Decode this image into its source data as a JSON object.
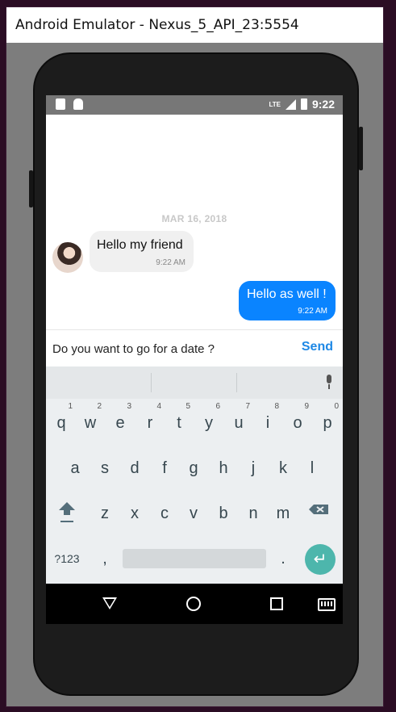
{
  "window": {
    "title": "Android Emulator - Nexus_5_API_23:5554"
  },
  "status_bar": {
    "network": "LTE",
    "time": "9:22"
  },
  "chat": {
    "date_separator": "MAR 16, 2018",
    "messages": [
      {
        "direction": "incoming",
        "text": "Hello my friend",
        "time": "9:22 AM"
      },
      {
        "direction": "outgoing",
        "text": "Hello as well !",
        "time": "9:22 AM"
      }
    ]
  },
  "composer": {
    "input_value": "Do you want to go for a date ?",
    "send_label": "Send"
  },
  "keyboard": {
    "row1": [
      {
        "ch": "q",
        "num": "1"
      },
      {
        "ch": "w",
        "num": "2"
      },
      {
        "ch": "e",
        "num": "3"
      },
      {
        "ch": "r",
        "num": "4"
      },
      {
        "ch": "t",
        "num": "5"
      },
      {
        "ch": "y",
        "num": "6"
      },
      {
        "ch": "u",
        "num": "7"
      },
      {
        "ch": "i",
        "num": "8"
      },
      {
        "ch": "o",
        "num": "9"
      },
      {
        "ch": "p",
        "num": "0"
      }
    ],
    "row2": [
      "a",
      "s",
      "d",
      "f",
      "g",
      "h",
      "j",
      "k",
      "l"
    ],
    "row3": [
      "z",
      "x",
      "c",
      "v",
      "b",
      "n",
      "m"
    ],
    "symbols_label": "?123",
    "comma": ",",
    "period": "."
  },
  "colors": {
    "outgoing_bubble": "#0a84ff",
    "send_text": "#1e88e5",
    "enter_key": "#4db6ac"
  }
}
